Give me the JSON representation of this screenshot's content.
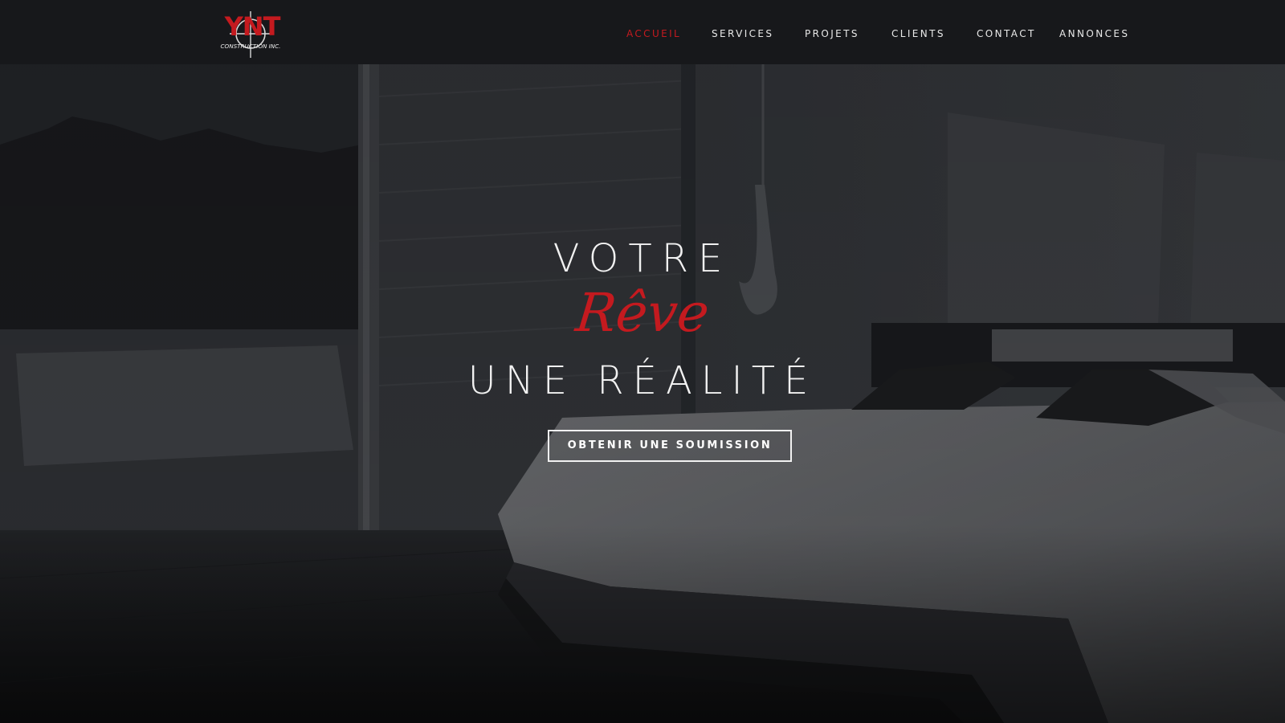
{
  "header": {
    "logo": {
      "text_main": "YNT",
      "text_sub": "CONSTRUCTION INC."
    },
    "nav": [
      {
        "label": "ACCUEIL",
        "active": true
      },
      {
        "label": "SERVICES",
        "active": false
      },
      {
        "label": "PROJETS",
        "active": false
      },
      {
        "label": "CLIENTS",
        "active": false
      },
      {
        "label": "CONTACT",
        "active": false
      },
      {
        "label": "ANNONCES",
        "active": false
      }
    ]
  },
  "hero": {
    "line1": "VOTRE",
    "line2": "Rêve",
    "line3": "UNE RÉALITÉ",
    "cta_label": "OBTENIR UNE SOUMISSION"
  },
  "colors": {
    "accent": "#c41a1f",
    "header_bg": "#17181b",
    "text": "#f1f1f1"
  }
}
